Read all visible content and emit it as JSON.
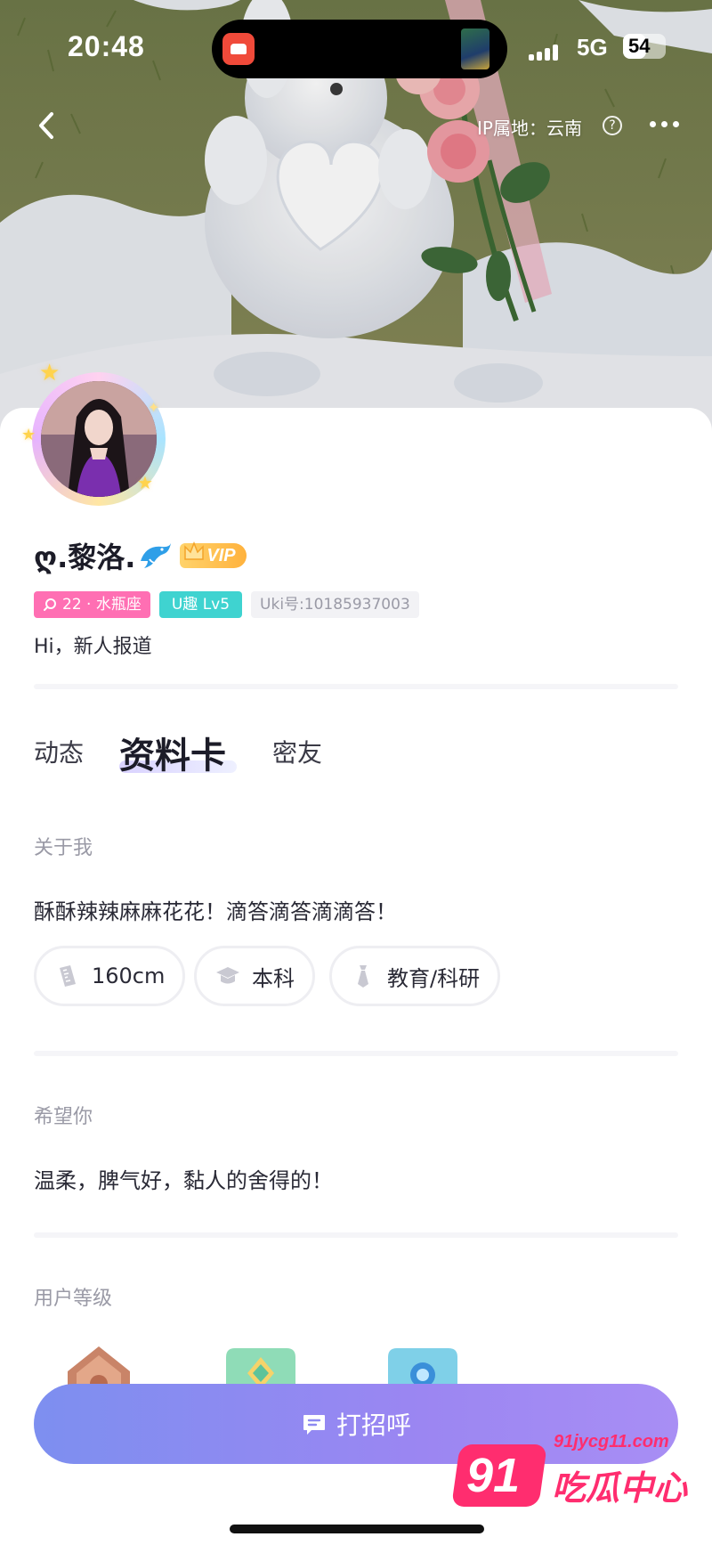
{
  "status_bar": {
    "time": "20:48",
    "network": "5G",
    "battery": "54",
    "battery_fraction": 0.54
  },
  "header": {
    "ip_location": "IP属地：云南",
    "help_symbol": "?"
  },
  "profile": {
    "nickname": "ღ.黎洛.",
    "vip_label": "VIP",
    "age_tag": "22 · 水瓶座",
    "level_tag": "U趣 Lv5",
    "uid_tag": "Uki号:10185937003",
    "bio": "Hi，新人报道"
  },
  "tabs": {
    "posts": "动态",
    "profile_card": "资料卡",
    "friends": "密友",
    "active": "profile_card"
  },
  "about": {
    "title": "关于我",
    "text": "酥酥辣辣麻麻花花！滴答滴答滴滴答！",
    "pills": [
      {
        "icon": "ruler-icon",
        "label": "160cm"
      },
      {
        "icon": "graduation-cap-icon",
        "label": "本科"
      },
      {
        "icon": "tie-icon",
        "label": "教育/科研"
      }
    ]
  },
  "hope": {
    "title": "希望你",
    "text": "温柔，脾气好，黏人的舍得的！"
  },
  "user_level": {
    "title": "用户等级",
    "icons": [
      "bronze-medal-icon",
      "green-level-icon",
      "blue-level-icon"
    ]
  },
  "actions": {
    "greet_label": "打招呼"
  },
  "watermark": {
    "number": "91",
    "url": "91jycg11.com",
    "text": "吃瓜中心"
  },
  "colors": {
    "accent_purple": "#9b86f2",
    "tag_pink": "#ff6fb3",
    "tag_teal": "#3fd3d0",
    "vip_gold": "#ffb23d",
    "watermark_pink": "#ff2d6f"
  }
}
